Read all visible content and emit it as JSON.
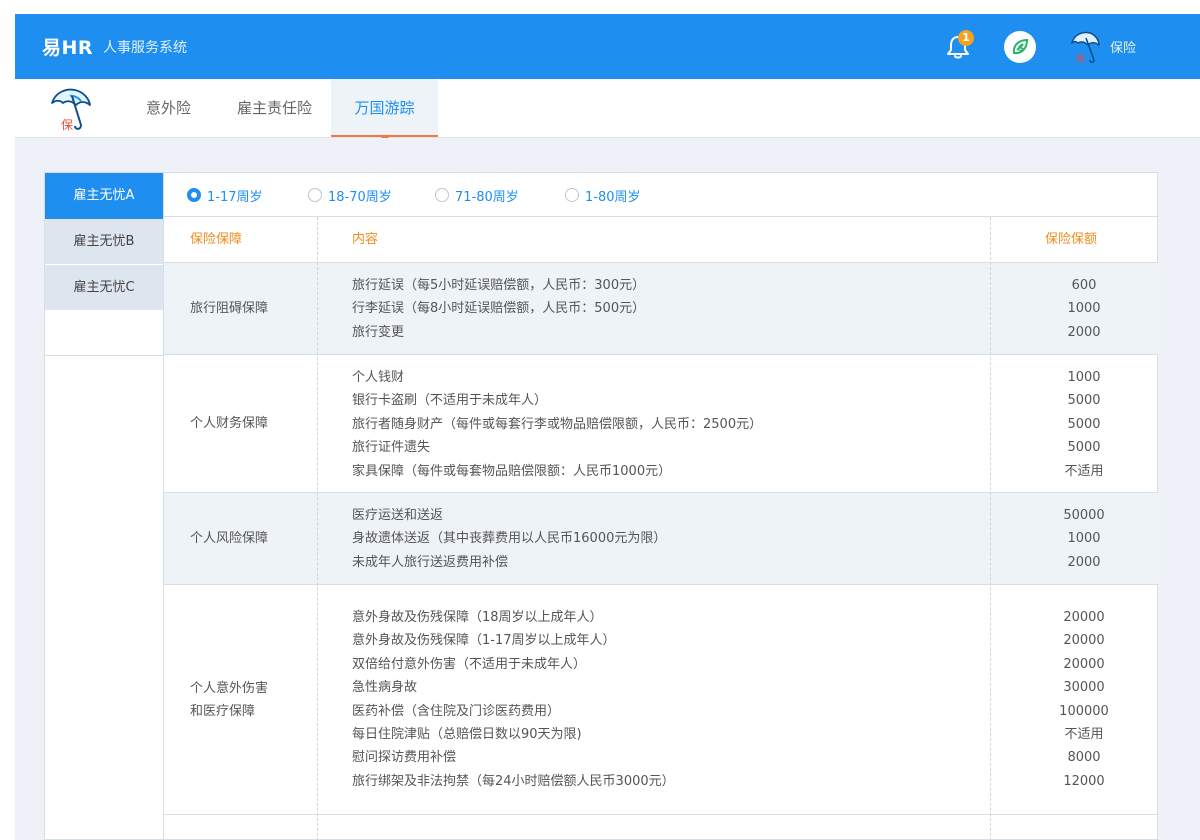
{
  "header": {
    "logo": "易HR",
    "subtitle": "人事服务系统",
    "notification_count": "1",
    "user_name": "保险",
    "user_badge": "保"
  },
  "tabs": [
    {
      "label": "意外险"
    },
    {
      "label": "雇主责任险"
    },
    {
      "label": "万国游踪"
    }
  ],
  "tab_logo_badge": "保",
  "plans": [
    {
      "label": "雇主无忧A"
    },
    {
      "label": "雇主无忧B"
    },
    {
      "label": "雇主无忧C"
    }
  ],
  "age_options": [
    {
      "label": "1-17周岁",
      "selected": true
    },
    {
      "label": "18-70周岁",
      "selected": false
    },
    {
      "label": "71-80周岁",
      "selected": false
    },
    {
      "label": "1-80周岁",
      "selected": false
    }
  ],
  "table": {
    "headers": [
      "保险保障",
      "内容",
      "保险保额"
    ],
    "sections": [
      {
        "title": [
          "旅行阻碍保障"
        ],
        "items": [
          "旅行延误（每5小时延误赔偿额，人民币：300元）",
          "行李延误（每8小时延误赔偿额，人民币：500元）",
          "旅行变更"
        ],
        "values": [
          "600",
          "1000",
          "2000"
        ]
      },
      {
        "title": [
          "个人财务保障"
        ],
        "items": [
          "个人钱财",
          "银行卡盗刷（不适用于未成年人）",
          "旅行者随身财产（每件或每套行李或物品赔偿限额，人民币：2500元）",
          "旅行证件遗失",
          "家具保障（每件或每套物品赔偿限额：人民币1000元）"
        ],
        "values": [
          "1000",
          "5000",
          "5000",
          "5000",
          "不适用"
        ]
      },
      {
        "title": [
          "个人风险保障"
        ],
        "items": [
          "医疗运送和送返",
          "身故遗体送返（其中丧葬费用以人民币16000元为限）",
          "未成年人旅行送返费用补偿"
        ],
        "values": [
          "50000",
          "1000",
          "2000"
        ]
      },
      {
        "title": [
          "个人意外伤害",
          "和医疗保障"
        ],
        "items": [
          "意外身故及伤残保障（18周岁以上成年人）",
          "意外身故及伤残保障（1-17周岁以上成年人）",
          "双倍给付意外伤害（不适用于未成年人）",
          "急性病身故",
          "医药补偿（含住院及门诊医药费用）",
          "每日住院津贴（总赔偿日数以90天为限)",
          "慰问探访费用补偿",
          "旅行绑架及非法拘禁（每24小时赔偿额人民币3000元）"
        ],
        "values": [
          "20000",
          "20000",
          "20000",
          "30000",
          "100000",
          "不适用",
          "8000",
          "12000"
        ]
      }
    ]
  },
  "colors": {
    "primary": "#1e8ff0",
    "accent_orange": "#f28c1e",
    "badge": "#f7a21b",
    "shade": "#eef3f8"
  }
}
